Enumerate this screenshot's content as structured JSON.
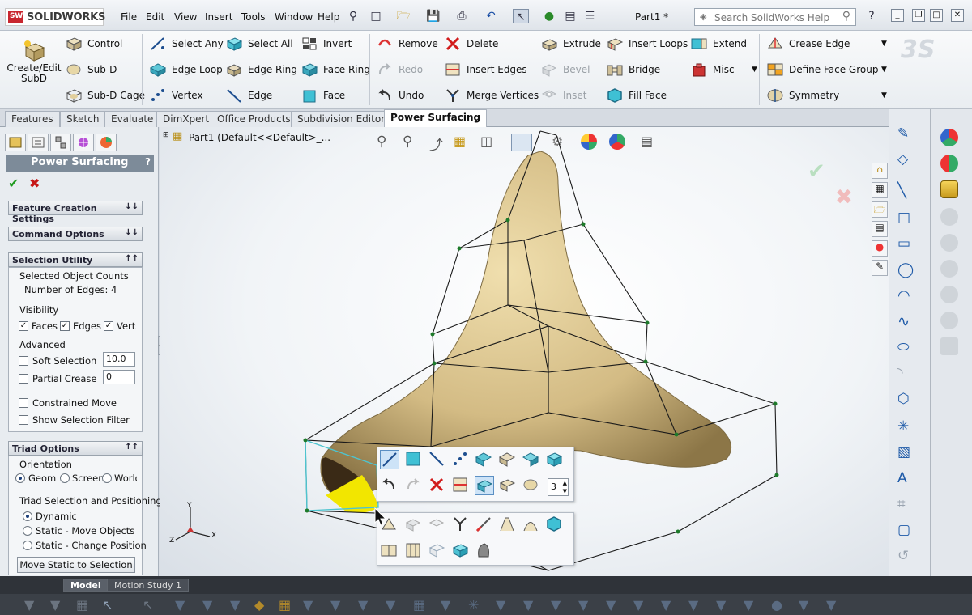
{
  "app": {
    "brand": "SOLIDWORKS",
    "brand_badge": "SW",
    "document_title": "Part1 *"
  },
  "menu": [
    "File",
    "Edit",
    "View",
    "Insert",
    "Tools",
    "Window",
    "Help"
  ],
  "search": {
    "placeholder": "Search SolidWorks Help"
  },
  "ribbon": {
    "create_edit": {
      "line1": "Create/Edit",
      "line2": "SubD"
    },
    "col1": [
      "Control",
      "Sub-D",
      "Sub-D Cage"
    ],
    "col2": [
      "Select Any",
      "Edge Loop",
      "Vertex"
    ],
    "col3": [
      "Select All",
      "Edge Ring",
      "Edge"
    ],
    "col4": [
      "Invert",
      "Face Ring",
      "Face"
    ],
    "col5": [
      "Remove",
      "Redo",
      "Undo"
    ],
    "col6": [
      "Delete",
      "Insert Edges",
      "Merge Vertices"
    ],
    "col7": [
      "Extrude",
      "Bevel",
      "Inset"
    ],
    "col8": [
      "Insert Loops",
      "Bridge",
      "Fill Face"
    ],
    "col9": [
      "Extend",
      "Misc"
    ],
    "col10": [
      "Crease Edge",
      "Define Face Group",
      "Symmetry"
    ]
  },
  "tabs": [
    "Features",
    "Sketch",
    "Evaluate",
    "DimXpert",
    "Office Products",
    "Subdivision Editor",
    "Power Surfacing"
  ],
  "active_tab": "Power Surfacing",
  "panel": {
    "title": "Power Surfacing",
    "help": "?",
    "sections": {
      "feature_creation": "Feature Creation Settings",
      "command_options": "Command Options",
      "selection_utility": "Selection Utility",
      "triad_options": "Triad Options"
    },
    "selected_counts_label": "Selected Object Counts",
    "edge_count_text": "Number of Edges: 4",
    "visibility_label": "Visibility",
    "visibility": [
      {
        "label": "Faces",
        "checked": true
      },
      {
        "label": "Edges",
        "checked": true
      },
      {
        "label": "Verts",
        "checked": true
      }
    ],
    "advanced_label": "Advanced",
    "soft_selection": {
      "label": "Soft Selection",
      "value": "10.0",
      "checked": false
    },
    "partial_crease": {
      "label": "Partial Crease",
      "value": "0",
      "checked": false
    },
    "constrained_move": "Constrained Move",
    "show_selection_filter": "Show Selection Filter",
    "orientation_label": "Orientation",
    "orientation": [
      {
        "label": "Geom",
        "selected": true
      },
      {
        "label": "Screen",
        "selected": false
      },
      {
        "label": "World",
        "selected": false
      }
    ],
    "triad_selection_label": "Triad Selection and Positioning",
    "triad_modes": [
      {
        "label": "Dynamic",
        "selected": true
      },
      {
        "label": "Static - Move Objects",
        "selected": false
      },
      {
        "label": "Static - Change Position",
        "selected": false
      }
    ],
    "move_static_button": "Move Static to Selection"
  },
  "tree": {
    "text": "Part1  (Default<<Default>_..."
  },
  "popup": {
    "spinner_value": "3"
  },
  "bottom_tabs": [
    "Model",
    "Motion Study 1"
  ],
  "colors": {
    "surface": "#d7c08f",
    "selection": "#f2e600",
    "accent": "#1e5aa8"
  }
}
